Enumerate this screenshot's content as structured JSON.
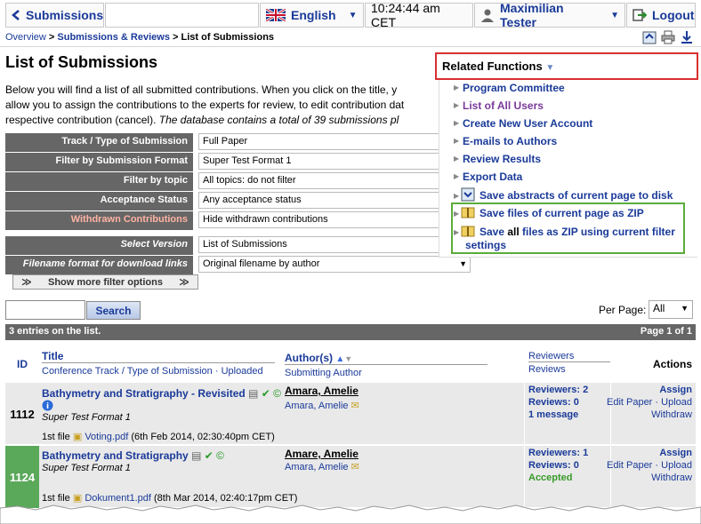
{
  "topbar": {
    "home_label": "Submissions",
    "language": "English",
    "time": "10:24:44 am CET",
    "user": "Maximilian Tester",
    "logout": "Logout"
  },
  "breadcrumb": {
    "overview": "Overview",
    "sep": ">",
    "reviews": "Submissions & Reviews",
    "current": "List of Submissions"
  },
  "page": {
    "title": "List of Submissions",
    "intro_1": "Below you will find a list of all submitted contributions. When you click on the title, y",
    "intro_2": "allow you to assign the contributions to the experts for review, to edit contribution dat",
    "intro_3a": "respective contribution (cancel). ",
    "intro_3b": "The database contains a total of 39 submissions pl"
  },
  "filters": [
    {
      "label": "Track / Type of Submission",
      "value": "Full Paper"
    },
    {
      "label": "Filter by Submission Format",
      "value": "Super Test Format 1"
    },
    {
      "label": "Filter by topic",
      "value": "All topics: do not filter"
    },
    {
      "label": "Acceptance Status",
      "value": "Any acceptance status"
    },
    {
      "label": "Withdrawn Contributions",
      "value": "Hide withdrawn contributions"
    },
    {
      "label": "Select Version",
      "value": "List of Submissions"
    },
    {
      "label": "Filename format for download links",
      "value": "Original filename by author"
    }
  ],
  "more_filters": "Show more filter options",
  "search": {
    "button": "Search",
    "placeholder": ""
  },
  "perpage": {
    "label": "Per Page:",
    "value": "All"
  },
  "entries": {
    "count": "3 entries on the list.",
    "page": "Page 1 of 1"
  },
  "table": {
    "headers": {
      "id": "ID",
      "title": "Title",
      "title_sub_a": "Conference Track / Type of Submission",
      "title_sub_b": "Uploaded",
      "authors": "Author(s)",
      "authors_sub": "Submitting Author",
      "reviewers": "Reviewers",
      "reviews": "Reviews",
      "actions": "Actions"
    },
    "rows": [
      {
        "id": "1112",
        "title": "Bathymetry and Stratigraphy - Revisited",
        "format": "Super Test Format 1",
        "file_prefix": "1st file",
        "file": "Voting.pdf",
        "file_date": "(6th Feb 2014, 02:30:40pm CET)",
        "author": "Amara, Amelie",
        "submitter": "Amara, Amelie",
        "reviewers": "Reviewers: 2",
        "reviews": "Reviews: 0",
        "extra": "1 message",
        "assign": "Assign",
        "edit": "Edit Paper",
        "upload": "Upload",
        "withdraw": "Withdraw"
      },
      {
        "id": "1124",
        "title": "Bathymetry and Stratigraphy",
        "format": "Super Test Format 1",
        "file_prefix": "1st file",
        "file": "Dokument1.pdf",
        "file_date": "(8th Mar 2014, 02:40:17pm CET)",
        "author": "Amare, Amelie",
        "submitter": "Amara, Amelie",
        "reviewers": "Reviewers: 1",
        "reviews": "Reviews: 0",
        "extra": "Accepted",
        "assign": "Assign",
        "edit": "Edit Paper",
        "upload": "Upload",
        "withdraw": "Withdraw"
      }
    ]
  },
  "related": {
    "title": "Related Functions",
    "items": [
      "Program Committee",
      "List of All Users",
      "Create New User Account",
      "E-mails to Authors",
      "Review Results",
      "Export Data",
      "Save abstracts of current page to disk",
      "Save files of current page as ZIP"
    ],
    "zip_all_a": "Save ",
    "zip_all_b": "all",
    "zip_all_c": " files as ZIP using current filter",
    "zip_all_d": "settings"
  },
  "colors": {
    "accent": "#1a3a99",
    "highlight_red": "#d93030",
    "highlight_green": "#5bad3a",
    "accepted": "#3a9a2a"
  }
}
